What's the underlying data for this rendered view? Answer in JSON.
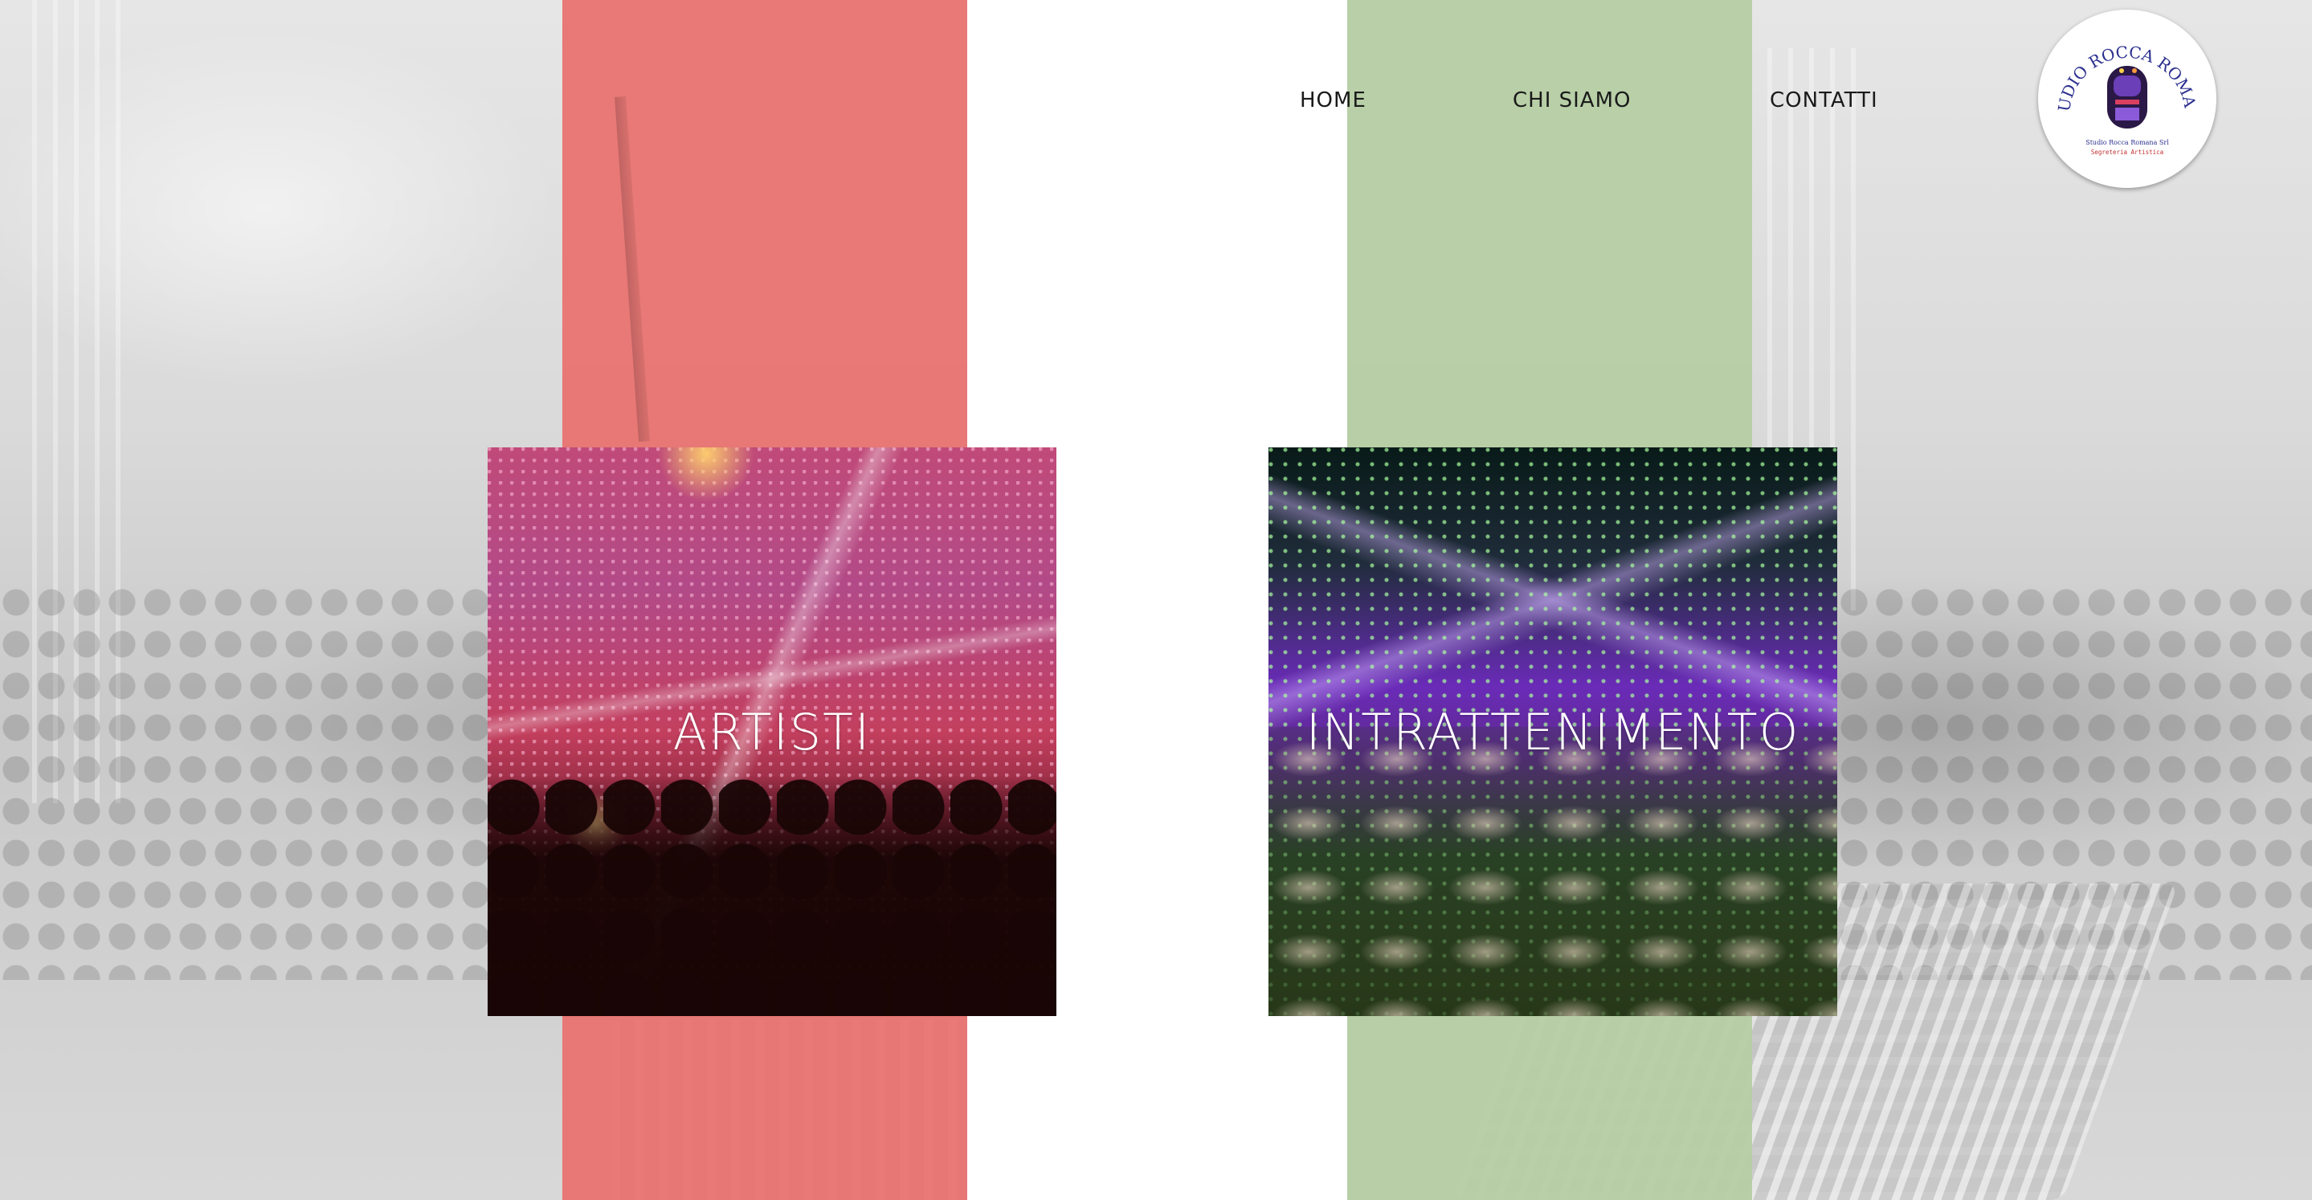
{
  "nav": {
    "items": [
      {
        "label": "HOME"
      },
      {
        "label": "CHI SIAMO"
      },
      {
        "label": "CONTATTI"
      }
    ]
  },
  "logo": {
    "text_arc": "STUDIO ROCCA ROMANA",
    "line1": "Studio Rocca Romana Srl",
    "line2": "Segreteria Artistica",
    "icon": "jukebox-icon"
  },
  "cards": [
    {
      "label": "ARTISTI",
      "image": "concert-crowd-image"
    },
    {
      "label": "INTRATTENIMENTO",
      "image": "event-venue-image"
    }
  ],
  "colors": {
    "flag_red": "#e87370",
    "flag_white": "#ffffff",
    "flag_green": "#b5cea3",
    "nav_text": "#1a1a1a",
    "card_text": "#ffffff"
  }
}
